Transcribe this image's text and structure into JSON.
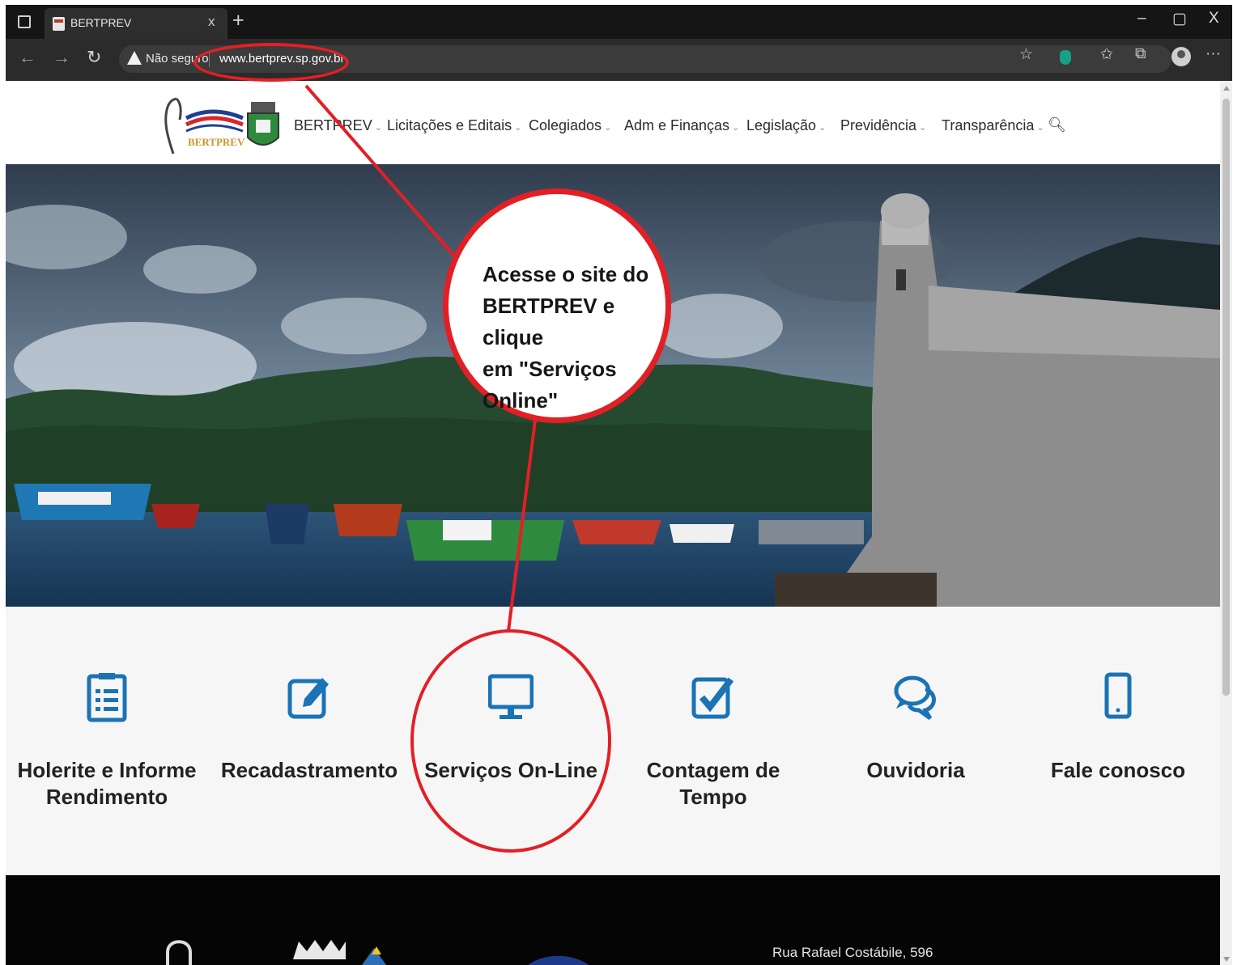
{
  "browser": {
    "tab_title": "BERTPREV",
    "tab_close": "x",
    "new_tab": "+",
    "window_controls": [
      "–",
      "▢",
      "X"
    ],
    "security_label": "Não seguro",
    "url": "www.bertprev.sp.gov.br",
    "toolbar_icons": [
      "star-add-icon",
      "extension-icon",
      "favorites-icon",
      "collections-icon",
      "profile-icon",
      "more-icon"
    ],
    "more": "···"
  },
  "site": {
    "logo_text": "BERTPREV",
    "nav": [
      {
        "label": "BERTPREV"
      },
      {
        "label": "Licitações e Editais"
      },
      {
        "label": "Colegiados"
      },
      {
        "label": "Adm e Finanças"
      },
      {
        "label": "Legislação"
      },
      {
        "label": "Previdência"
      },
      {
        "label": "Transparência"
      }
    ]
  },
  "services": [
    {
      "label_line1": "Holerite e Informe",
      "label_line2": "Rendimento",
      "icon": "document-list-icon"
    },
    {
      "label_line1": "Recadastramento",
      "label_line2": "",
      "icon": "edit-icon"
    },
    {
      "label_line1": "Serviços On-Line",
      "label_line2": "",
      "icon": "monitor-icon"
    },
    {
      "label_line1": "Contagem de",
      "label_line2": "Tempo",
      "icon": "checkbox-icon"
    },
    {
      "label_line1": "Ouvidoria",
      "label_line2": "",
      "icon": "chat-bubbles-icon"
    },
    {
      "label_line1": "Fale conosco",
      "label_line2": "",
      "icon": "mobile-icon"
    }
  ],
  "footer": {
    "address": "Rua Rafael Costábile, 596"
  },
  "annotation": {
    "line1": "Acesse o site do",
    "line2": "BERTPREV e clique",
    "line3": "em \"Serviços Online\""
  },
  "colors": {
    "accent": "#1a73b5",
    "annotation": "#e31f26",
    "chrome": "#2b2b2b"
  }
}
